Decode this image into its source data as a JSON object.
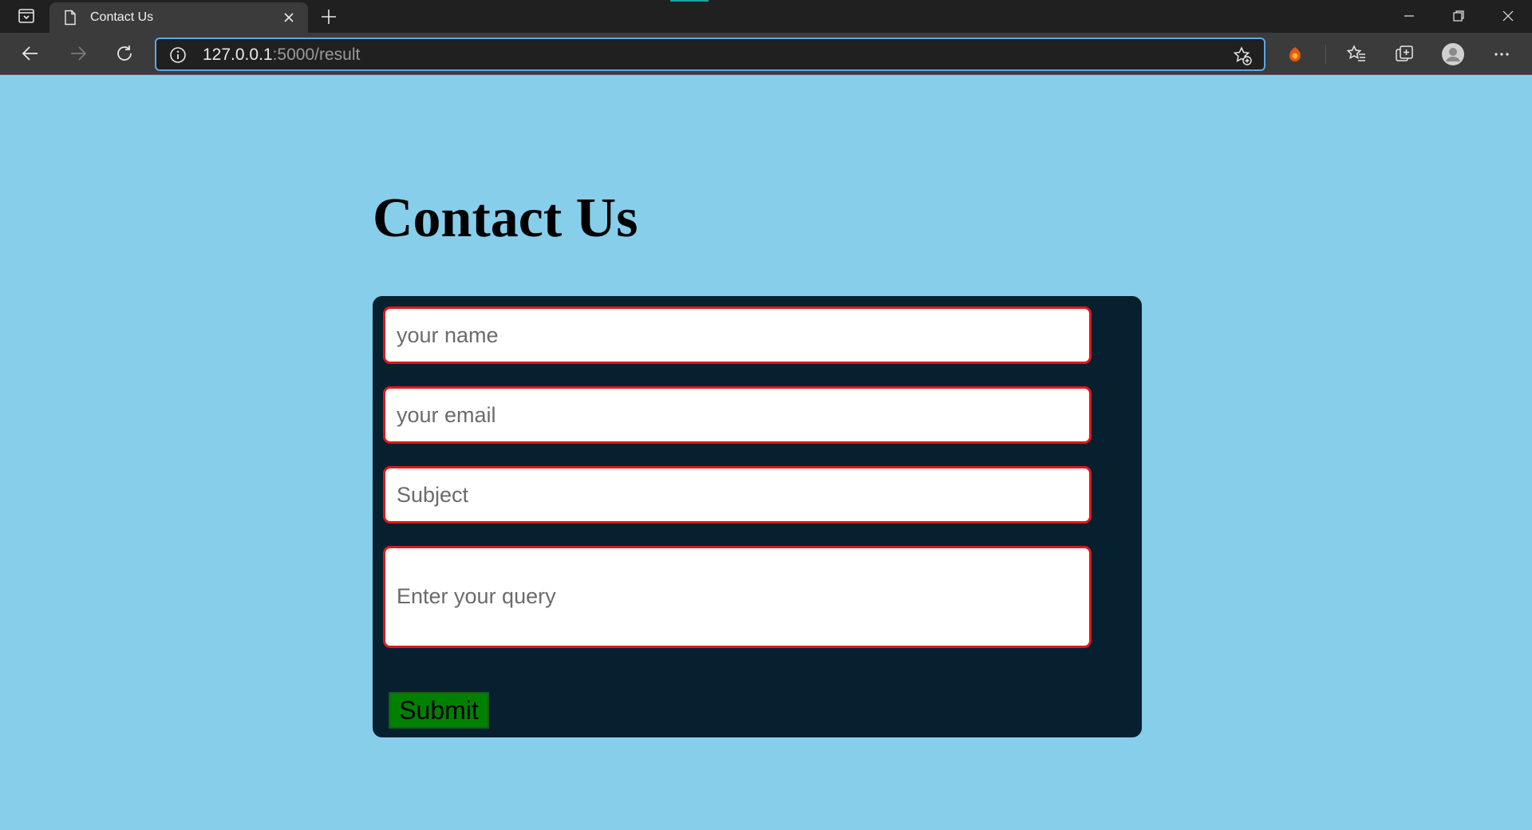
{
  "browser": {
    "tab_title": "Contact Us",
    "url_host": "127.0.0.1",
    "url_path": ":5000/result",
    "icons": [
      "tab-actions-icon",
      "page-icon",
      "close-icon",
      "plus-icon",
      "minimize-icon",
      "restore-icon",
      "close-window-icon",
      "back-arrow-icon",
      "forward-arrow-icon",
      "refresh-icon",
      "info-icon",
      "add-favorite-icon",
      "extension-icon",
      "favorites-icon",
      "collections-icon",
      "profile-avatar-icon",
      "more-icon"
    ]
  },
  "page": {
    "title": "Contact Us",
    "form": {
      "name_placeholder": "your name",
      "email_placeholder": "your email",
      "subject_placeholder": "Subject",
      "query_placeholder": "Enter your query",
      "submit_label": "Submit"
    }
  },
  "colors": {
    "page_background": "#87ceeb",
    "form_background": "#062030",
    "field_border": "#e01818",
    "submit_background": "#008000"
  }
}
